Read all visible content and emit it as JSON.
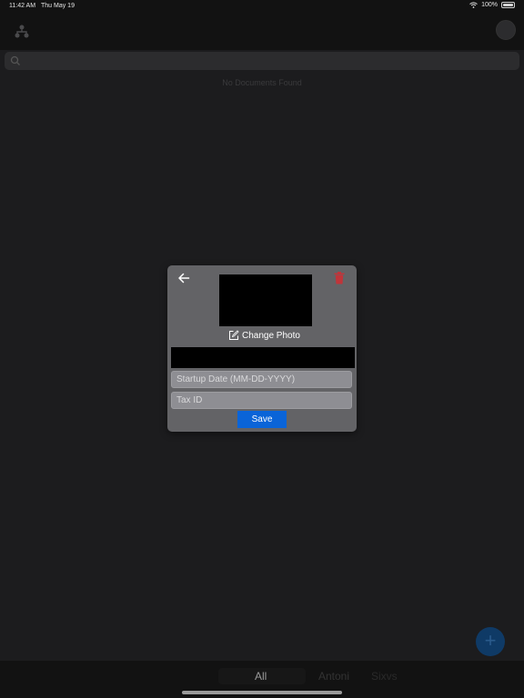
{
  "status_bar": {
    "time": "11:42 AM",
    "date": "Thu May 19",
    "battery": "100%"
  },
  "search": {
    "placeholder": ""
  },
  "main": {
    "empty_message": "No Documents Found"
  },
  "bottom_tabs": [
    {
      "label": "All",
      "selected": true,
      "color": "#9a9a9a"
    },
    {
      "label": "Antoni",
      "selected": false,
      "color": "#333333"
    },
    {
      "label": "Sixvs",
      "selected": false,
      "color": "#2a2a2a"
    }
  ],
  "fab": {
    "label": "+"
  },
  "modal": {
    "change_photo_label": "Change Photo",
    "name_value": "",
    "startup_date_placeholder": "Startup Date (MM-DD-YYYY)",
    "tax_id_placeholder": "Tax ID",
    "save_label": "Save"
  },
  "colors": {
    "accent": "#0a64d8",
    "delete": "#c0353a",
    "background": "#1c1c1e",
    "modal": "#636366"
  },
  "icons": {
    "back": "arrow-left-icon",
    "delete": "trash-icon",
    "edit": "edit-icon",
    "search": "search-icon",
    "wifi": "wifi-icon",
    "battery": "battery-icon"
  }
}
